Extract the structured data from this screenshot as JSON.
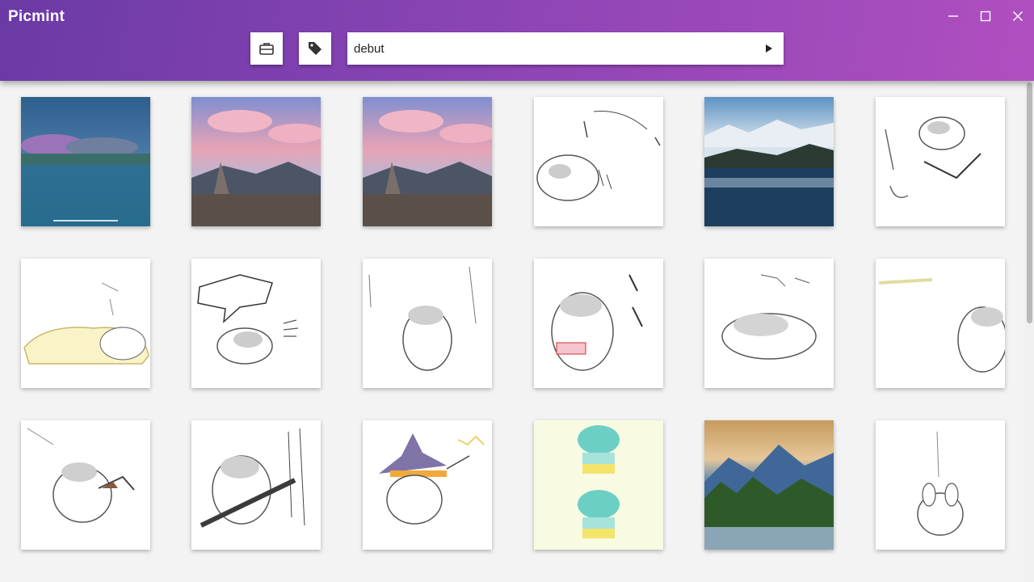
{
  "window": {
    "title": "Picmint",
    "controls": [
      "minimize-icon",
      "maximize-icon",
      "close-icon"
    ]
  },
  "toolbar": {
    "briefcase_icon": "briefcase-icon",
    "tag_icon": "tag-icon",
    "search_value": "debut",
    "go_icon": "play-icon"
  },
  "gallery": {
    "columns": 6,
    "rows": 3,
    "tiles": [
      {
        "kind": "lake-fog"
      },
      {
        "kind": "cairn-sunset"
      },
      {
        "kind": "cairn-sunset"
      },
      {
        "kind": "hamster-sketch-pose"
      },
      {
        "kind": "mountain-lake"
      },
      {
        "kind": "hamster-sketch-jump"
      },
      {
        "kind": "hamster-blanket"
      },
      {
        "kind": "hamster-shout"
      },
      {
        "kind": "hamster-standing"
      },
      {
        "kind": "hamster-snack"
      },
      {
        "kind": "hamster-lying"
      },
      {
        "kind": "hamster-peek"
      },
      {
        "kind": "hamster-trident"
      },
      {
        "kind": "hamster-stick"
      },
      {
        "kind": "hamster-witch"
      },
      {
        "kind": "frog-girl"
      },
      {
        "kind": "mountain-forest"
      },
      {
        "kind": "rabbit-sketch"
      }
    ]
  },
  "colors": {
    "accent_start": "#6a3aa6",
    "accent_end": "#b04fc0",
    "tile_bg": "#ffffff"
  }
}
